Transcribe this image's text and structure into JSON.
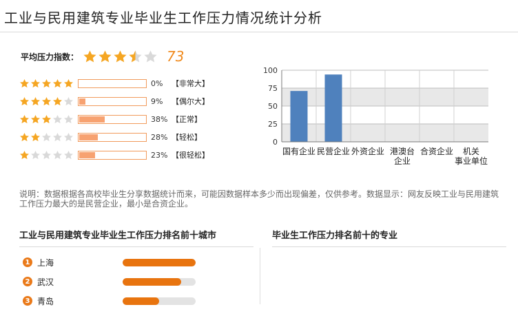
{
  "page": {
    "title": "工业与民用建筑专业毕业生工作压力情况统计分析"
  },
  "colors": {
    "star_filled": "#f5a623",
    "star_empty": "#d9d9d9",
    "score": "#f08a1d",
    "bar_fill": "#f7a271",
    "bar_border": "#f19a5b",
    "chart_bar": "#4f81bd",
    "rank": "#e8740f"
  },
  "average": {
    "label": "平均压力指数：",
    "stars": 3.5,
    "score": "73"
  },
  "ratings": [
    {
      "stars": 5,
      "percent": "0%",
      "fraction": 0.0,
      "tag": "【非常大】"
    },
    {
      "stars": 4,
      "percent": "9%",
      "fraction": 0.09,
      "tag": "【偶尔大】"
    },
    {
      "stars": 3,
      "percent": "38%",
      "fraction": 0.38,
      "tag": "【正常】"
    },
    {
      "stars": 2,
      "percent": "28%",
      "fraction": 0.28,
      "tag": "【轻松】"
    },
    {
      "stars": 1,
      "percent": "23%",
      "fraction": 0.23,
      "tag": "【很轻松】"
    }
  ],
  "chart_data": {
    "type": "bar",
    "categories": [
      "国有企业",
      "民营企业",
      "外资企业",
      "港澳台企业",
      "合资企业",
      "机关事业单位"
    ],
    "category_lines": [
      [
        "国有企业"
      ],
      [
        "民营企业"
      ],
      [
        "外资企业"
      ],
      [
        "港澳台",
        "企业"
      ],
      [
        "合资企业"
      ],
      [
        "机关",
        "事业单位"
      ]
    ],
    "values": [
      71,
      94,
      0,
      0,
      0,
      0
    ],
    "ylim": [
      0,
      100
    ],
    "yticks": [
      0,
      25,
      50,
      75,
      100
    ],
    "grid": true,
    "title": "",
    "xlabel": "",
    "ylabel": ""
  },
  "note": "说明：数据根据各高校毕业生分享数据统计而来，可能因数据样本多少而出现偏差，仅供参考。数据显示：网友反映工业与民用建筑工作压力最大的是民营企业，最小是合资企业。",
  "left_section": {
    "title": "工业与民用建筑专业毕业生工作压力排名前十城市",
    "items": [
      {
        "rank": "1",
        "name": "上海",
        "fraction": 1.0
      },
      {
        "rank": "2",
        "name": "武汉",
        "fraction": 0.8
      },
      {
        "rank": "3",
        "name": "青岛",
        "fraction": 0.5
      }
    ]
  },
  "right_section": {
    "title": "毕业生工作压力排名前十的专业"
  }
}
